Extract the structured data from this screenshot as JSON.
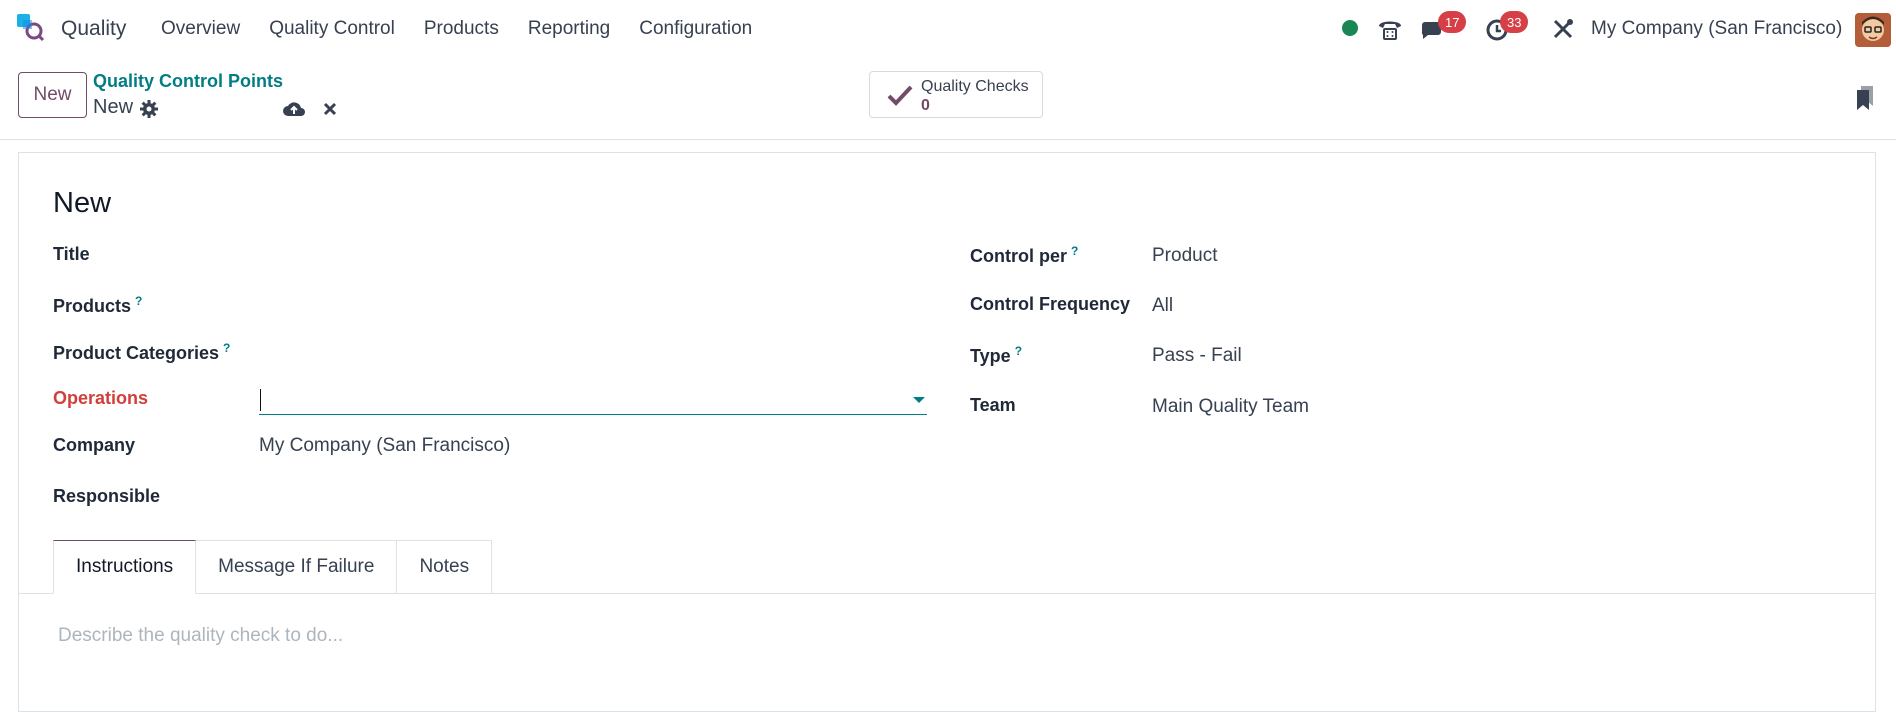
{
  "navbar": {
    "app_name": "Quality",
    "menu": [
      "Overview",
      "Quality Control",
      "Products",
      "Reporting",
      "Configuration"
    ],
    "messages_count": "17",
    "activities_count": "33",
    "company": "My Company (San Francisco)",
    "icons": [
      "app-logo",
      "status-dot",
      "phone-icon",
      "chat-icon",
      "clock-icon",
      "tools-icon",
      "avatar"
    ]
  },
  "control_panel": {
    "new_label": "New",
    "breadcrumb": "Quality Control Points",
    "record_name": "New",
    "smart_button": {
      "label": "Quality Checks",
      "value": "0"
    }
  },
  "form": {
    "title": "New",
    "left_fields": {
      "title_label": "Title",
      "products_label": "Products",
      "categories_label": "Product Categories",
      "operations_label": "Operations",
      "operations_value": "",
      "company_label": "Company",
      "company_value": "My Company (San Francisco)",
      "responsible_label": "Responsible"
    },
    "right_fields": {
      "control_per_label": "Control per",
      "control_per_value": "Product",
      "frequency_label": "Control Frequency",
      "frequency_value": "All",
      "type_label": "Type",
      "type_value": "Pass - Fail",
      "team_label": "Team",
      "team_value": "Main Quality Team"
    },
    "help_mark": "?",
    "tabs": [
      "Instructions",
      "Message If Failure",
      "Notes"
    ],
    "active_tab": "Instructions",
    "instructions_placeholder": "Describe the quality check to do..."
  },
  "colors": {
    "brand": "#714b67",
    "accent": "#017e84",
    "required": "#d23f3a",
    "badge": "#d63f46",
    "online": "#198754"
  }
}
